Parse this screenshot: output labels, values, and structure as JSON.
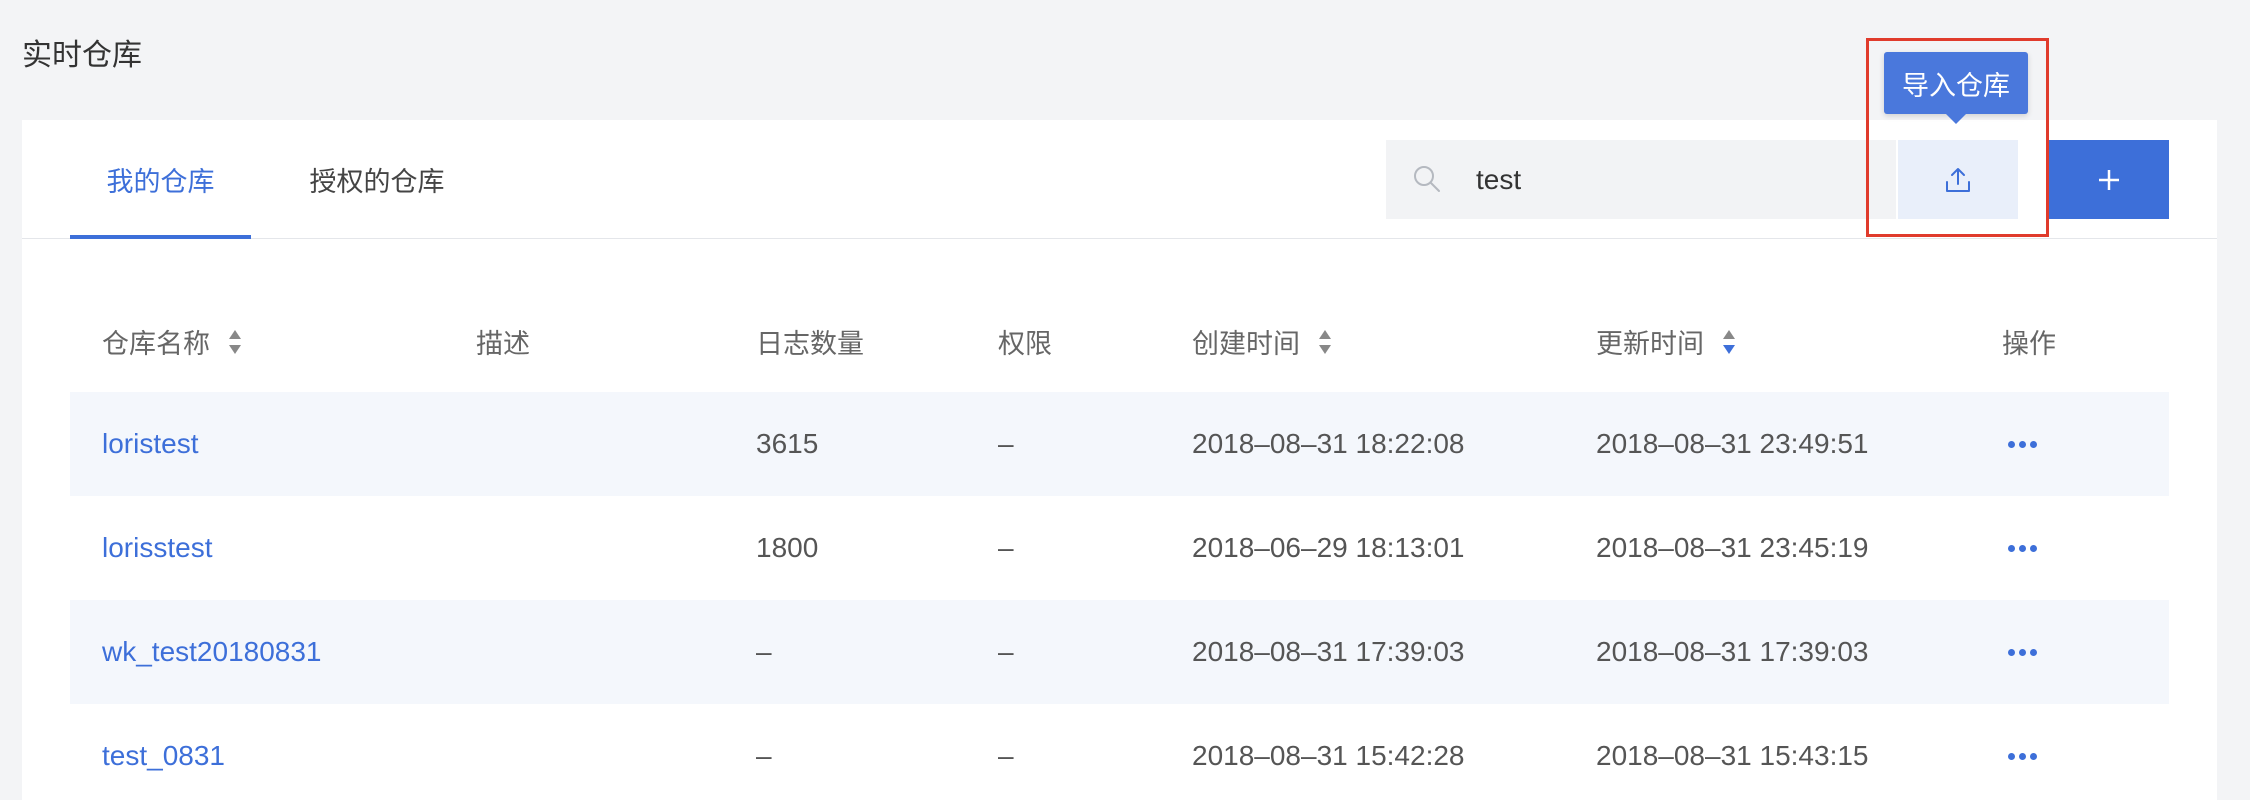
{
  "page": {
    "title": "实时仓库"
  },
  "tabs": [
    {
      "label": "我的仓库",
      "active": true
    },
    {
      "label": "授权的仓库",
      "active": false
    }
  ],
  "search": {
    "value": "test",
    "icon": "search-icon"
  },
  "toolbar": {
    "import_tooltip": "导入仓库",
    "import_icon": "upload-icon",
    "add_icon": "plus-icon"
  },
  "colors": {
    "accent": "#3d6fd9",
    "highlight": "#e03b2c",
    "row_alt": "#f4f7fc"
  },
  "table": {
    "columns": [
      {
        "label": "仓库名称",
        "sortable": true,
        "sort_state": "none"
      },
      {
        "label": "描述",
        "sortable": false
      },
      {
        "label": "日志数量",
        "sortable": false
      },
      {
        "label": "权限",
        "sortable": false
      },
      {
        "label": "创建时间",
        "sortable": true,
        "sort_state": "none"
      },
      {
        "label": "更新时间",
        "sortable": true,
        "sort_state": "desc"
      },
      {
        "label": "操作",
        "sortable": false
      }
    ],
    "rows": [
      {
        "name": "loristest",
        "desc": "",
        "count": "3615",
        "perm": "–",
        "created": "2018–08–31 18:22:08",
        "updated": "2018–08–31 23:49:51"
      },
      {
        "name": "lorisstest",
        "desc": "",
        "count": "1800",
        "perm": "–",
        "created": "2018–06–29 18:13:01",
        "updated": "2018–08–31 23:45:19"
      },
      {
        "name": "wk_test20180831",
        "desc": "",
        "count": "–",
        "perm": "–",
        "created": "2018–08–31 17:39:03",
        "updated": "2018–08–31 17:39:03"
      },
      {
        "name": "test_0831",
        "desc": "",
        "count": "–",
        "perm": "–",
        "created": "2018–08–31 15:42:28",
        "updated": "2018–08–31 15:43:15"
      }
    ]
  }
}
